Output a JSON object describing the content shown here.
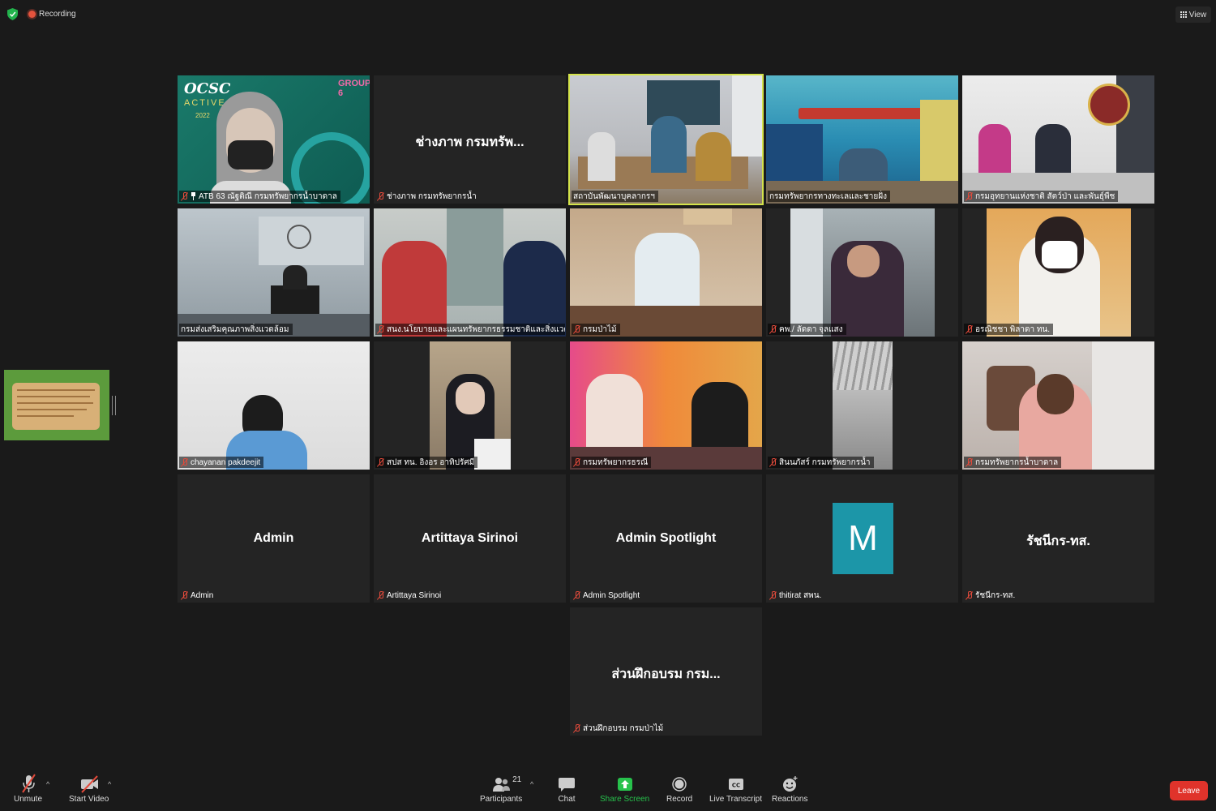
{
  "topbar": {
    "recording_label": "Recording",
    "view_label": "View"
  },
  "tiles": [
    {
      "name": "ATB 63 ณัฐติณี กรมทรัพยากรน้ำบาดาล",
      "big": "",
      "type": "video",
      "pinned": true
    },
    {
      "name": "ช่างภาพ กรมทรัพยากรน้ำ",
      "big": "ช่างภาพ กรมทรัพ...",
      "type": "name"
    },
    {
      "name": "สถาบันพัฒนาบุคลากรฯ",
      "big": "",
      "type": "video",
      "active": true
    },
    {
      "name": "กรมทรัพยากรทางทะเลและชายฝั่ง",
      "big": "",
      "type": "video"
    },
    {
      "name": "กรมอุทยานแห่งชาติ สัตว์ป่า และพันธุ์พืช",
      "big": "",
      "type": "video"
    },
    {
      "name": "กรมส่งเสริมคุณภาพสิ่งแวดล้อม",
      "big": "",
      "type": "video",
      "nomic": true
    },
    {
      "name": "สนง.นโยบายและแผนทรัพยากรธรรมชาติและสิ่งแวดล้อม",
      "big": "",
      "type": "video"
    },
    {
      "name": "กรมป่าไม้",
      "big": "",
      "type": "video"
    },
    {
      "name": "คพ./ ลัดดา จุลแสง",
      "big": "",
      "type": "video"
    },
    {
      "name": "อรณิชชา พิลาดา ทน.",
      "big": "",
      "type": "video"
    },
    {
      "name": "chayanan pakdeejit",
      "big": "",
      "type": "video"
    },
    {
      "name": "สปส ทน. อิงอร อาทิปรัศมี",
      "big": "",
      "type": "video"
    },
    {
      "name": "กรมทรัพยากรธรณี",
      "big": "",
      "type": "video"
    },
    {
      "name": "สินนภัสร์ กรมทรัพยากรน้ำ",
      "big": "",
      "type": "video"
    },
    {
      "name": "กรมทรัพยากรน้ำบาดาล",
      "big": "",
      "type": "video"
    },
    {
      "name": "Admin",
      "big": "Admin",
      "type": "name"
    },
    {
      "name": "Artittaya Sirinoi",
      "big": "Artittaya Sirinoi",
      "type": "name"
    },
    {
      "name": "Admin Spotlight",
      "big": "Admin Spotlight",
      "type": "name"
    },
    {
      "name": "thitirat สพน.",
      "big": "",
      "type": "avatar",
      "avatar_letter": "M"
    },
    {
      "name": "รัชนีกร-ทส.",
      "big": "รัชนีกร-ทส.",
      "type": "name"
    },
    {
      "name": "ส่วนฝึกอบรม กรมป่าไม้",
      "big": "ส่วนฝึกอบรม กรม...",
      "type": "name"
    }
  ],
  "toolbar": {
    "unmute": "Unmute",
    "start_video": "Start Video",
    "participants": "Participants",
    "participants_count": "21",
    "chat": "Chat",
    "share_screen": "Share Screen",
    "record": "Record",
    "live_transcript": "Live Transcript",
    "reactions": "Reactions",
    "leave": "Leave"
  },
  "colors": {
    "background": "#1a1a1a",
    "active_speaker": "#d4e34b",
    "share_green": "#27c24c",
    "leave_red": "#e0332b",
    "avatar_teal": "#1c96a8"
  }
}
